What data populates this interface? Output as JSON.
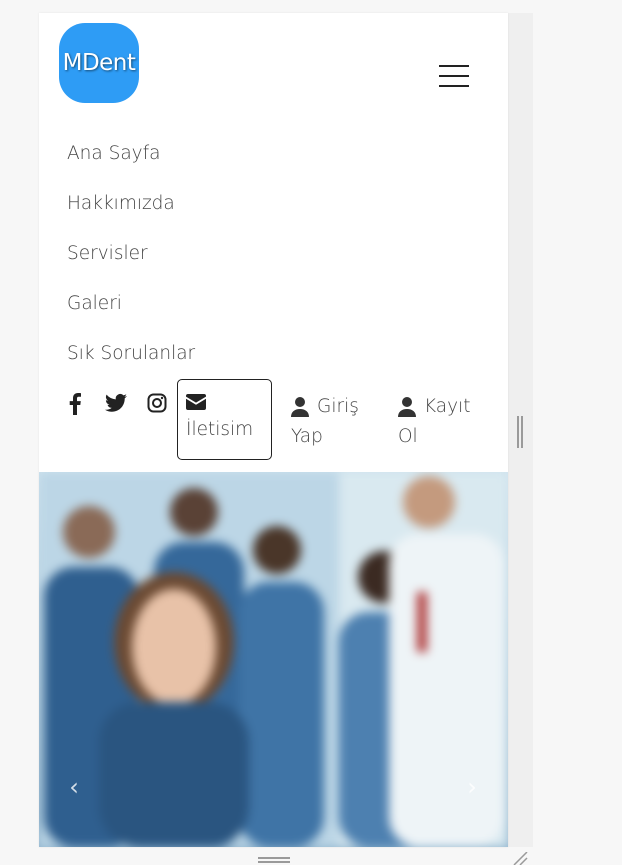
{
  "brand": {
    "logo_text": "MDent",
    "color": "#2e9cf5"
  },
  "nav": {
    "items": [
      {
        "label": "Ana Sayfa"
      },
      {
        "label": "Hakkımızda"
      },
      {
        "label": "Servisler"
      },
      {
        "label": "Galeri"
      },
      {
        "label": "Sık Sorulanlar"
      }
    ]
  },
  "social": {
    "icons": [
      "facebook-icon",
      "twitter-icon",
      "instagram-icon"
    ]
  },
  "actions": {
    "contact_label": "İletisim",
    "login_line1": "Giriş",
    "login_line2": "Yap",
    "register_line1": "Kayıt",
    "register_line2": "Ol"
  },
  "carousel": {
    "prev_glyph": "‹",
    "next_glyph": "›"
  }
}
